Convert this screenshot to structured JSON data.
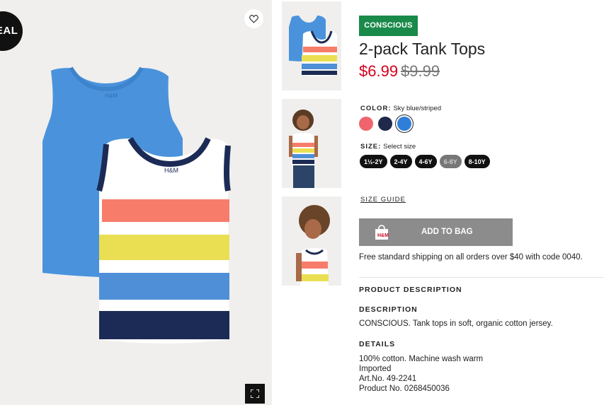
{
  "main_image": {
    "deal_badge": "DEAL"
  },
  "product": {
    "badge": "CONSCIOUS",
    "title": "2-pack Tank Tops",
    "price_sale": "$6.99",
    "price_original": "$9.99",
    "color_label": "COLOR:",
    "color_value": "Sky blue/striped",
    "size_label": "SIZE:",
    "size_value": "Select size",
    "sizes": [
      "1½-2Y",
      "2-4Y",
      "4-6Y",
      "6-8Y",
      "8-10Y"
    ],
    "size_guide": "SIZE GUIDE",
    "add_to_bag": "ADD TO BAG",
    "shipping_note": "Free standard shipping on all orders over $40 with code 0040.",
    "product_description_heading": "PRODUCT DESCRIPTION",
    "description_heading": "DESCRIPTION",
    "description_text": "CONSCIOUS. Tank tops in soft, organic cotton jersey.",
    "details_heading": "DETAILS",
    "details_lines": [
      "100% cotton. Machine wash warm",
      "Imported",
      "Art.No. 49-2241",
      "Product No. 0268450036"
    ]
  },
  "colors": {
    "sale_red": "#d6001c",
    "conscious_green": "#1a8a4a",
    "swatch_coral": "#f0646e",
    "swatch_navy": "#1f2a4a",
    "swatch_blue": "#2f7fd9",
    "disabled_button": "#8c8c8c"
  }
}
